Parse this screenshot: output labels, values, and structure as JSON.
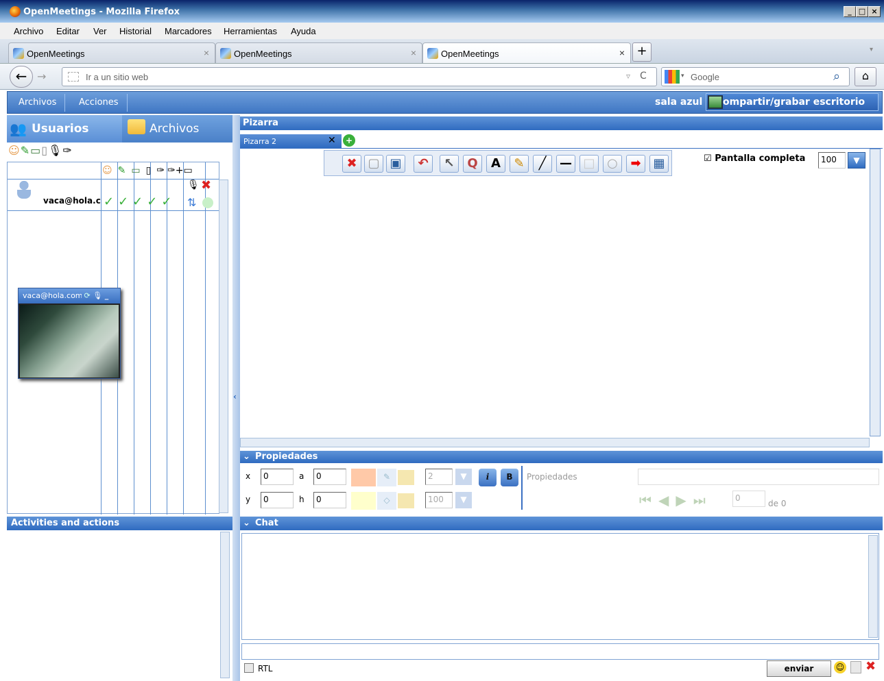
{
  "window": {
    "title": "OpenMeetings - Mozilla Firefox"
  },
  "menu": [
    "Archivo",
    "Editar",
    "Ver",
    "Historial",
    "Marcadores",
    "Herramientas",
    "Ayuda"
  ],
  "tabs": [
    {
      "label": "OpenMeetings",
      "active": false
    },
    {
      "label": "OpenMeetings",
      "active": false
    },
    {
      "label": "OpenMeetings",
      "active": true
    }
  ],
  "nav": {
    "url_placeholder": "Ir a un sitio web",
    "search_placeholder": "Google"
  },
  "app_toolbar": {
    "menu1": "Archivos",
    "menu2": "Acciones",
    "room_name": "sala azul",
    "share_label": "ompartir/grabar escritorio"
  },
  "left_tabs": {
    "users": "Usuarios",
    "files": "Archivos"
  },
  "users": [
    {
      "email": "vaca@hola.com"
    }
  ],
  "video_pod": {
    "name": "vaca@hola.com"
  },
  "activities": {
    "title": "Activities and actions"
  },
  "whiteboard": {
    "section_title": "Pizarra",
    "tab_label": "Pizarra 2",
    "fullscreen_label": "Pantalla completa",
    "zoom_value": "100"
  },
  "properties": {
    "section_title": "Propiedades",
    "x_label": "x",
    "x_value": "0",
    "a_label": "a",
    "a_value": "0",
    "y_label": "y",
    "y_value": "0",
    "h_label": "h",
    "h_value": "0",
    "line_width": "2",
    "opacity": "100",
    "italic": "i",
    "bold": "B",
    "props_label": "Propiedades",
    "page_value": "0",
    "page_of": "de 0"
  },
  "chat": {
    "section_title": "Chat",
    "rtl_label": "RTL",
    "send_label": "enviar"
  },
  "colors": {
    "accent": "#3f76c3",
    "header": "#2f6bc0",
    "fill_color": "#ffc9a8",
    "line_color": "#ffffcc"
  }
}
